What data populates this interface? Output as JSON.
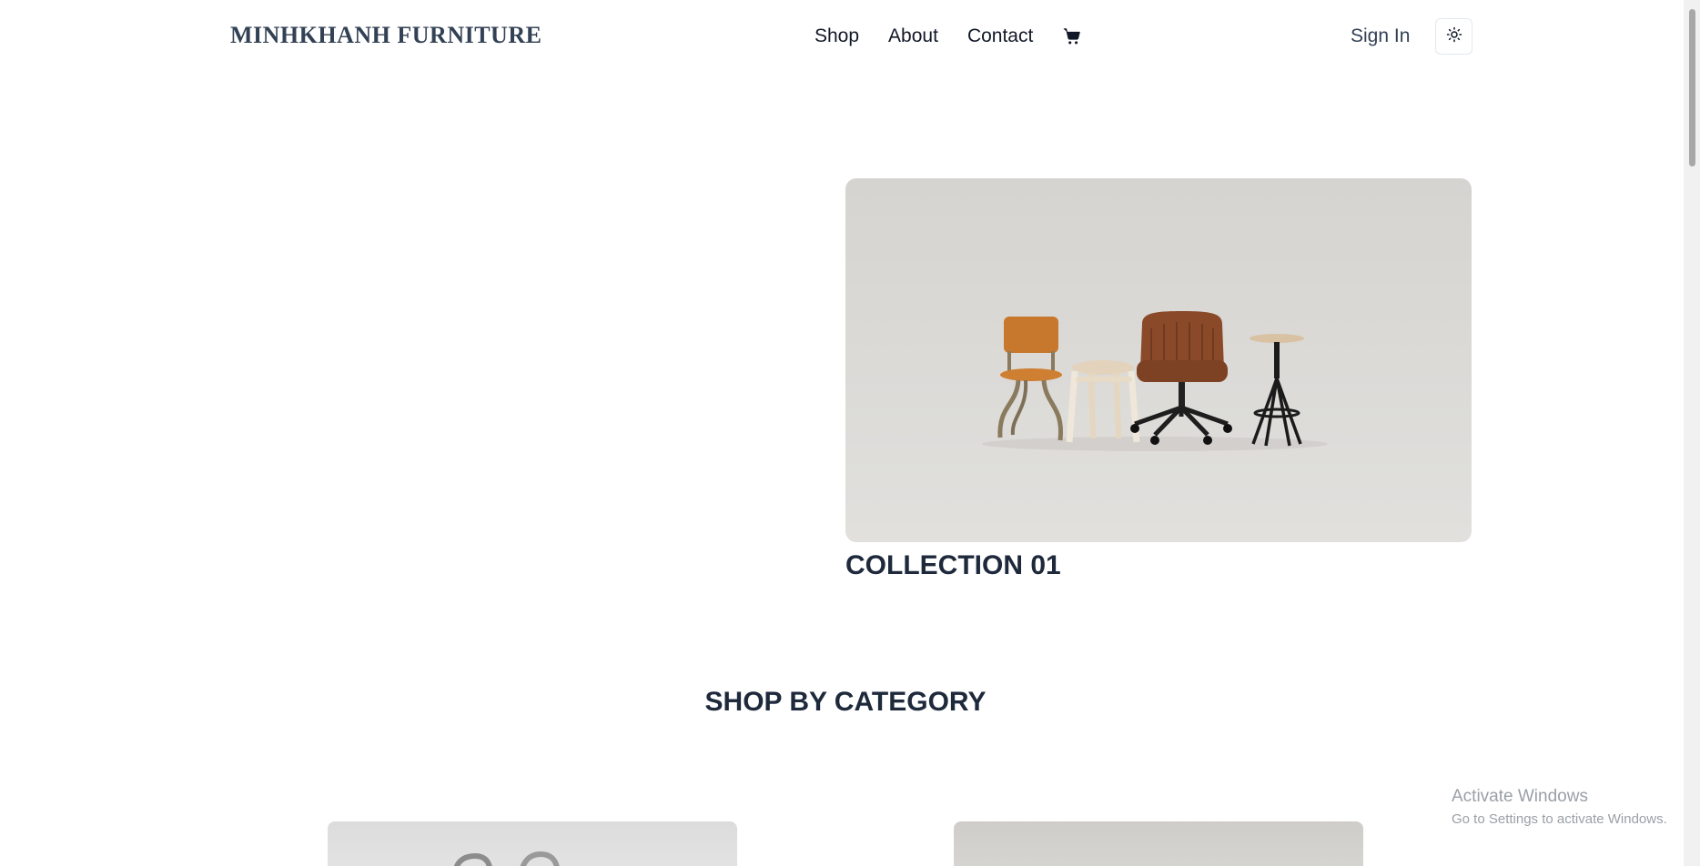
{
  "header": {
    "brand": "MINHKHANH FURNITURE",
    "nav": {
      "shop": "Shop",
      "about": "About",
      "contact": "Contact"
    },
    "cart_icon": "shopping-cart-icon",
    "sign_in": "Sign In",
    "theme_icon": "sun-icon"
  },
  "hero": {
    "caption": "COLLECTION 01"
  },
  "categories": {
    "title": "SHOP BY CATEGORY"
  },
  "overlay": {
    "activate_title": "Activate Windows",
    "activate_sub": "Go to Settings to activate Windows."
  },
  "colors": {
    "text_dark": "#1e293b",
    "brand": "#334155",
    "background": "#ffffff"
  }
}
